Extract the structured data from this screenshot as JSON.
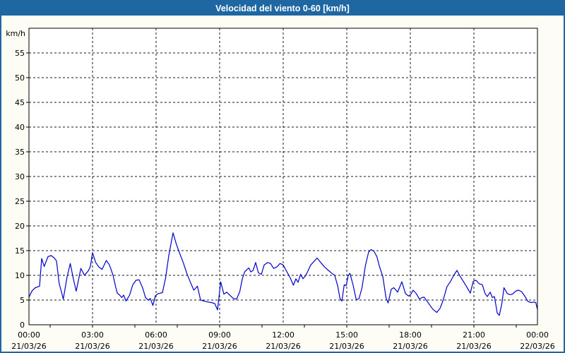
{
  "window_title": "Velocidad del viento 0-60 [km/h]",
  "colors": {
    "titlebar_bg": "#1f67a3",
    "titlebar_text": "#ffffff",
    "window_bg": "#fdfdf5",
    "window_border": "#1f67a3",
    "plot_bg": "#ffffff",
    "plot_border": "#000000",
    "grid": "#1a1a1a",
    "line": "#0000cc",
    "label_text": "#000000"
  },
  "chart_data": {
    "type": "line",
    "title": "Velocidad del viento 0-60 [km/h]",
    "xlabel": "",
    "ylabel": "km/h",
    "ylim": [
      0,
      60
    ],
    "ytick_step": 5,
    "y_gridlines": [
      5,
      10,
      15,
      20,
      25,
      30,
      35,
      40,
      45,
      50,
      55
    ],
    "y_tick_labels": [
      0,
      5,
      10,
      15,
      20,
      25,
      30,
      35,
      40,
      45,
      50,
      55
    ],
    "x_range_hours": [
      0,
      24
    ],
    "x_gridline_hours": [
      3,
      6,
      9,
      12,
      15,
      18,
      21
    ],
    "x_minor_tick_hours": [
      1,
      3,
      5,
      7,
      9,
      11,
      13,
      15,
      17,
      19,
      21,
      23
    ],
    "x_ticks": [
      {
        "h": 0,
        "time": "00:00",
        "date": "21/03/26"
      },
      {
        "h": 3,
        "time": "03:00",
        "date": "21/03/26"
      },
      {
        "h": 6,
        "time": "06:00",
        "date": "21/03/26"
      },
      {
        "h": 9,
        "time": "09:00",
        "date": "21/03/26"
      },
      {
        "h": 12,
        "time": "12:00",
        "date": "21/03/26"
      },
      {
        "h": 15,
        "time": "15:00",
        "date": "21/03/26"
      },
      {
        "h": 18,
        "time": "18:00",
        "date": "21/03/26"
      },
      {
        "h": 21,
        "time": "21:00",
        "date": "21/03/26"
      },
      {
        "h": 24,
        "time": "00:00",
        "date": "22/03/26"
      }
    ],
    "grid_style": "dashed",
    "legend": "none",
    "series": [
      {
        "name": "Velocidad del viento",
        "color": "#0000cc",
        "points": [
          [
            0.0,
            5.6
          ],
          [
            0.15,
            6.9
          ],
          [
            0.3,
            7.5
          ],
          [
            0.5,
            7.8
          ],
          [
            0.6,
            13.4
          ],
          [
            0.72,
            11.8
          ],
          [
            0.9,
            13.8
          ],
          [
            1.05,
            14.0
          ],
          [
            1.2,
            13.5
          ],
          [
            1.3,
            12.9
          ],
          [
            1.42,
            8.5
          ],
          [
            1.62,
            5.2
          ],
          [
            1.8,
            9.7
          ],
          [
            1.95,
            12.4
          ],
          [
            2.1,
            9.2
          ],
          [
            2.23,
            6.8
          ],
          [
            2.45,
            11.4
          ],
          [
            2.62,
            10.0
          ],
          [
            2.8,
            10.9
          ],
          [
            2.9,
            11.8
          ],
          [
            3.0,
            14.6
          ],
          [
            3.15,
            12.6
          ],
          [
            3.3,
            11.7
          ],
          [
            3.45,
            11.2
          ],
          [
            3.65,
            13.0
          ],
          [
            3.8,
            12.1
          ],
          [
            3.97,
            10.0
          ],
          [
            4.1,
            7.5
          ],
          [
            4.17,
            6.4
          ],
          [
            4.28,
            6.0
          ],
          [
            4.38,
            5.5
          ],
          [
            4.47,
            6.0
          ],
          [
            4.58,
            4.8
          ],
          [
            4.75,
            6.0
          ],
          [
            4.9,
            8.1
          ],
          [
            5.05,
            9.0
          ],
          [
            5.2,
            9.1
          ],
          [
            5.37,
            7.4
          ],
          [
            5.5,
            5.5
          ],
          [
            5.63,
            5.0
          ],
          [
            5.73,
            5.3
          ],
          [
            5.85,
            3.9
          ],
          [
            5.97,
            5.9
          ],
          [
            6.1,
            6.3
          ],
          [
            6.3,
            6.5
          ],
          [
            6.45,
            9.5
          ],
          [
            6.6,
            14.0
          ],
          [
            6.8,
            18.6
          ],
          [
            6.95,
            16.4
          ],
          [
            7.1,
            14.6
          ],
          [
            7.28,
            12.6
          ],
          [
            7.45,
            10.4
          ],
          [
            7.62,
            8.6
          ],
          [
            7.78,
            7.0
          ],
          [
            7.95,
            7.8
          ],
          [
            8.1,
            5.0
          ],
          [
            8.27,
            4.8
          ],
          [
            8.45,
            4.6
          ],
          [
            8.6,
            4.5
          ],
          [
            8.77,
            4.3
          ],
          [
            8.9,
            3.0
          ],
          [
            9.05,
            8.7
          ],
          [
            9.2,
            6.2
          ],
          [
            9.33,
            6.6
          ],
          [
            9.5,
            5.9
          ],
          [
            9.65,
            5.3
          ],
          [
            9.8,
            5.2
          ],
          [
            9.95,
            6.7
          ],
          [
            10.07,
            9.3
          ],
          [
            10.18,
            10.7
          ],
          [
            10.3,
            11.2
          ],
          [
            10.38,
            11.5
          ],
          [
            10.47,
            10.7
          ],
          [
            10.58,
            11.0
          ],
          [
            10.7,
            12.6
          ],
          [
            10.83,
            10.5
          ],
          [
            10.97,
            10.2
          ],
          [
            11.1,
            12.1
          ],
          [
            11.27,
            12.6
          ],
          [
            11.4,
            12.4
          ],
          [
            11.55,
            11.4
          ],
          [
            11.7,
            11.7
          ],
          [
            11.85,
            12.4
          ],
          [
            12.0,
            12.1
          ],
          [
            12.15,
            10.9
          ],
          [
            12.33,
            9.5
          ],
          [
            12.48,
            8.0
          ],
          [
            12.6,
            9.3
          ],
          [
            12.7,
            8.6
          ],
          [
            12.82,
            10.2
          ],
          [
            12.93,
            9.3
          ],
          [
            13.07,
            10.0
          ],
          [
            13.3,
            12.1
          ],
          [
            13.6,
            13.5
          ],
          [
            13.77,
            12.6
          ],
          [
            13.95,
            11.7
          ],
          [
            14.13,
            11.0
          ],
          [
            14.3,
            10.4
          ],
          [
            14.43,
            10.0
          ],
          [
            14.57,
            7.9
          ],
          [
            14.68,
            5.3
          ],
          [
            14.77,
            4.8
          ],
          [
            14.88,
            8.1
          ],
          [
            14.97,
            7.9
          ],
          [
            15.07,
            10.0
          ],
          [
            15.15,
            10.4
          ],
          [
            15.3,
            8.0
          ],
          [
            15.45,
            5.0
          ],
          [
            15.58,
            5.3
          ],
          [
            15.72,
            7.5
          ],
          [
            15.88,
            12.0
          ],
          [
            16.03,
            14.7
          ],
          [
            16.15,
            15.2
          ],
          [
            16.28,
            14.9
          ],
          [
            16.42,
            13.8
          ],
          [
            16.55,
            11.7
          ],
          [
            16.7,
            9.8
          ],
          [
            16.85,
            5.5
          ],
          [
            16.95,
            4.4
          ],
          [
            17.1,
            7.2
          ],
          [
            17.22,
            7.5
          ],
          [
            17.4,
            6.6
          ],
          [
            17.6,
            8.7
          ],
          [
            17.77,
            6.3
          ],
          [
            17.92,
            5.8
          ],
          [
            18.03,
            6.2
          ],
          [
            18.13,
            7.0
          ],
          [
            18.28,
            6.3
          ],
          [
            18.43,
            5.2
          ],
          [
            18.55,
            5.5
          ],
          [
            18.65,
            5.6
          ],
          [
            18.9,
            4.1
          ],
          [
            19.07,
            3.1
          ],
          [
            19.25,
            2.5
          ],
          [
            19.4,
            3.3
          ],
          [
            19.55,
            5.0
          ],
          [
            19.73,
            7.7
          ],
          [
            19.9,
            8.8
          ],
          [
            20.05,
            10.0
          ],
          [
            20.2,
            11.0
          ],
          [
            20.35,
            9.8
          ],
          [
            20.5,
            8.8
          ],
          [
            20.67,
            7.6
          ],
          [
            20.83,
            6.4
          ],
          [
            20.97,
            8.8
          ],
          [
            21.1,
            9.0
          ],
          [
            21.25,
            8.3
          ],
          [
            21.4,
            8.1
          ],
          [
            21.52,
            6.4
          ],
          [
            21.63,
            5.7
          ],
          [
            21.77,
            6.6
          ],
          [
            21.87,
            5.5
          ],
          [
            21.97,
            5.7
          ],
          [
            22.1,
            2.4
          ],
          [
            22.2,
            1.9
          ],
          [
            22.32,
            4.3
          ],
          [
            22.42,
            7.5
          ],
          [
            22.58,
            6.3
          ],
          [
            22.7,
            6.1
          ],
          [
            22.82,
            6.2
          ],
          [
            22.97,
            6.8
          ],
          [
            23.1,
            7.0
          ],
          [
            23.25,
            6.7
          ],
          [
            23.4,
            5.8
          ],
          [
            23.55,
            4.7
          ],
          [
            23.7,
            4.5
          ],
          [
            23.83,
            4.6
          ],
          [
            23.92,
            4.5
          ],
          [
            24.0,
            3.1
          ]
        ]
      }
    ]
  }
}
